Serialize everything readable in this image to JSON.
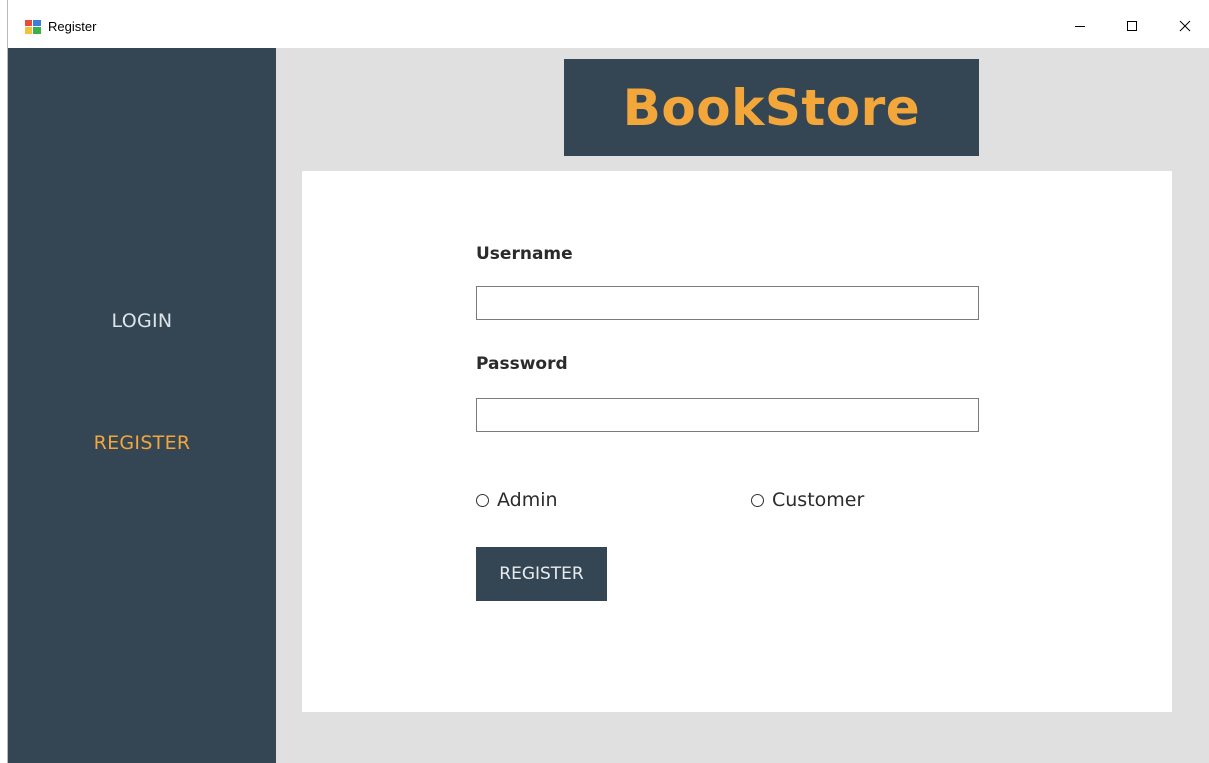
{
  "window": {
    "title": "Register",
    "minimize_glyph": "–",
    "maximize_glyph": "☐",
    "close_glyph": "✕"
  },
  "sidebar": {
    "items": [
      {
        "label": "LOGIN",
        "active": false
      },
      {
        "label": "REGISTER",
        "active": true
      }
    ]
  },
  "header": {
    "logo_text": "BookStore"
  },
  "form": {
    "username_label": "Username",
    "username_value": "",
    "password_label": "Password",
    "password_value": "",
    "roles": [
      {
        "label": "Admin",
        "selected": false
      },
      {
        "label": "Customer",
        "selected": false
      }
    ],
    "submit_label": "REGISTER"
  },
  "colors": {
    "sidebar_bg": "#344654",
    "accent": "#f3a73b",
    "content_bg": "#e0e0e0",
    "panel_bg": "#ffffff"
  }
}
